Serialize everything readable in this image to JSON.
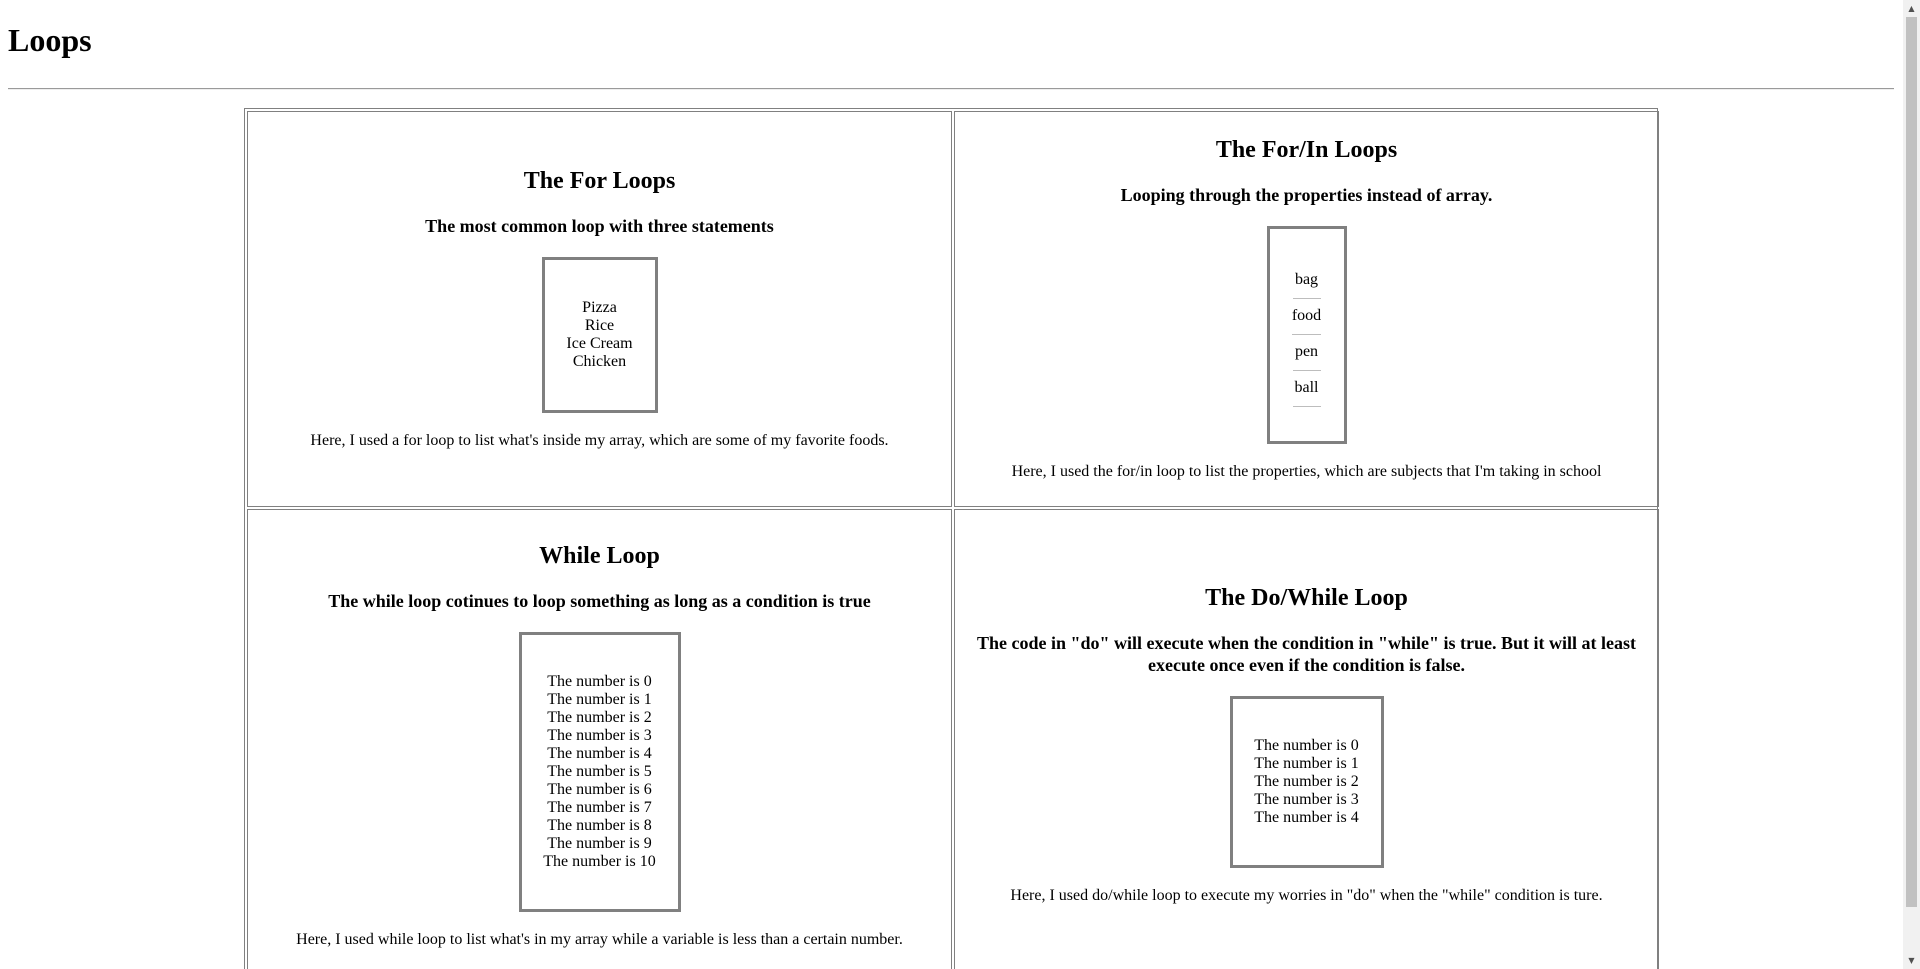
{
  "page": {
    "title": "Loops"
  },
  "cells": {
    "for": {
      "heading": "The For Loops",
      "subheading": "The most common loop with three statements",
      "output": [
        "Pizza",
        "Rice",
        "Ice Cream",
        "Chicken"
      ],
      "description": "Here, I used a for loop to list what's inside my array, which are some of my favorite foods."
    },
    "forin": {
      "heading": "The For/In Loops",
      "subheading": "Looping through the properties instead of array.",
      "output": [
        "bag",
        "food",
        "pen",
        "ball"
      ],
      "description": "Here, I used the for/in loop to list the properties, which are subjects that I'm taking in school"
    },
    "while": {
      "heading": "While Loop",
      "subheading": "The while loop cotinues to loop something as long as a condition is true",
      "output": [
        "The number is 0",
        "The number is 1",
        "The number is 2",
        "The number is 3",
        "The number is 4",
        "The number is 5",
        "The number is 6",
        "The number is 7",
        "The number is 8",
        "The number is 9",
        "The number is 10"
      ],
      "description": "Here, I used while loop to list what's in my array while a variable is less than a certain number."
    },
    "dowhile": {
      "heading": "The Do/While Loop",
      "subheading": "The code in \"do\" will execute when the condition in \"while\" is true. But it will at least execute once even if the condition is false.",
      "output": [
        "The number is 0",
        "The number is 1",
        "The number is 2",
        "The number is 3",
        "The number is 4"
      ],
      "description": "Here, I used do/while loop to execute my worries in \"do\" when the \"while\" condition is ture."
    }
  },
  "scrollbar": {
    "up_icon": "arrow-up-icon",
    "down_icon": "arrow-down-icon"
  }
}
